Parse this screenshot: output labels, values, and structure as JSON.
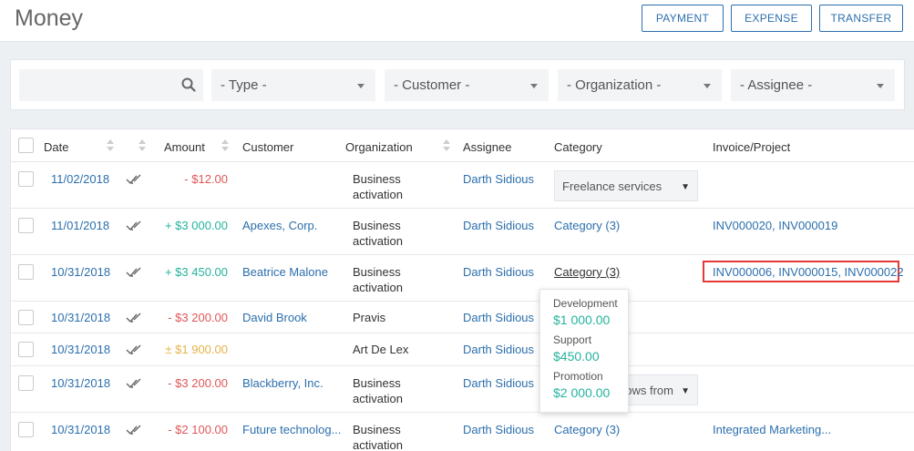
{
  "header": {
    "title": "Money",
    "payment_label": "PAYMENT",
    "expense_label": "EXPENSE",
    "transfer_label": "TRANSFER"
  },
  "filters": {
    "search_placeholder": "",
    "type": "- Type -",
    "customer": "- Customer -",
    "organization": "- Organization -",
    "assignee": "- Assignee -"
  },
  "table": {
    "columns": {
      "date": "Date",
      "amount": "Amount",
      "customer": "Customer",
      "organization": "Organization",
      "assignee": "Assignee",
      "category": "Category",
      "invoice": "Invoice/Project"
    },
    "rows": [
      {
        "date": "11/02/2018",
        "amount": "- $12.00",
        "amount_type": "neg",
        "customer": "",
        "org_line1": "Business",
        "org_line2": "activation",
        "assignee": "Darth Sidious",
        "category": "Freelance services",
        "category_kind": "select",
        "invoice": ""
      },
      {
        "date": "11/01/2018",
        "amount": "+ $3 000.00",
        "amount_type": "pos",
        "customer": "Apexes, Corp.",
        "org_line1": "Business",
        "org_line2": "activation",
        "assignee": "Darth Sidious",
        "category": "Category (3)",
        "category_kind": "link",
        "invoice": "INV000020, INV000019"
      },
      {
        "date": "10/31/2018",
        "amount": "+ $3 450.00",
        "amount_type": "pos",
        "customer": "Beatrice Malone",
        "org_line1": "Business",
        "org_line2": "activation",
        "assignee": "Darth Sidious",
        "category": "Category (3)",
        "category_kind": "link-hover",
        "invoice": "INV000006, INV000015, INV000022"
      },
      {
        "date": "10/31/2018",
        "amount": "- $3 200.00",
        "amount_type": "neg",
        "customer": "David Brook",
        "org_line1": "Pravis",
        "org_line2": "",
        "assignee": "Darth Sidious",
        "category": "",
        "category_kind": "none",
        "invoice": ""
      },
      {
        "date": "10/31/2018",
        "amount": "± $1 900.00",
        "amount_type": "mixed",
        "customer": "",
        "org_line1": "Art De Lex",
        "org_line2": "",
        "assignee": "Darth Sidious",
        "category": "",
        "category_kind": "none",
        "invoice": ""
      },
      {
        "date": "10/31/2018",
        "amount": "- $3 200.00",
        "amount_type": "neg",
        "customer": "Blackberry, Inc.",
        "org_line1": "Business",
        "org_line2": "activation",
        "assignee": "Darth Sidious",
        "category": "ows from",
        "category_kind": "select-partial",
        "invoice": ""
      },
      {
        "date": "10/31/2018",
        "amount": "- $2 100.00",
        "amount_type": "neg",
        "customer": "Future technolog...",
        "org_line1": "Business",
        "org_line2": "activation",
        "assignee": "Darth Sidious",
        "category": "Category (3)",
        "category_kind": "link",
        "invoice": "Integrated Marketing..."
      }
    ]
  },
  "tooltip": {
    "items": [
      {
        "label": "Development",
        "value": "$1 000.00"
      },
      {
        "label": "Support",
        "value": "$450.00"
      },
      {
        "label": "Promotion",
        "value": "$2 000.00"
      }
    ]
  },
  "colors": {
    "accent": "#2c6fad",
    "negative": "#e05656",
    "positive": "#25b39e",
    "mixed": "#e6b34a",
    "highlight": "#e53935"
  }
}
